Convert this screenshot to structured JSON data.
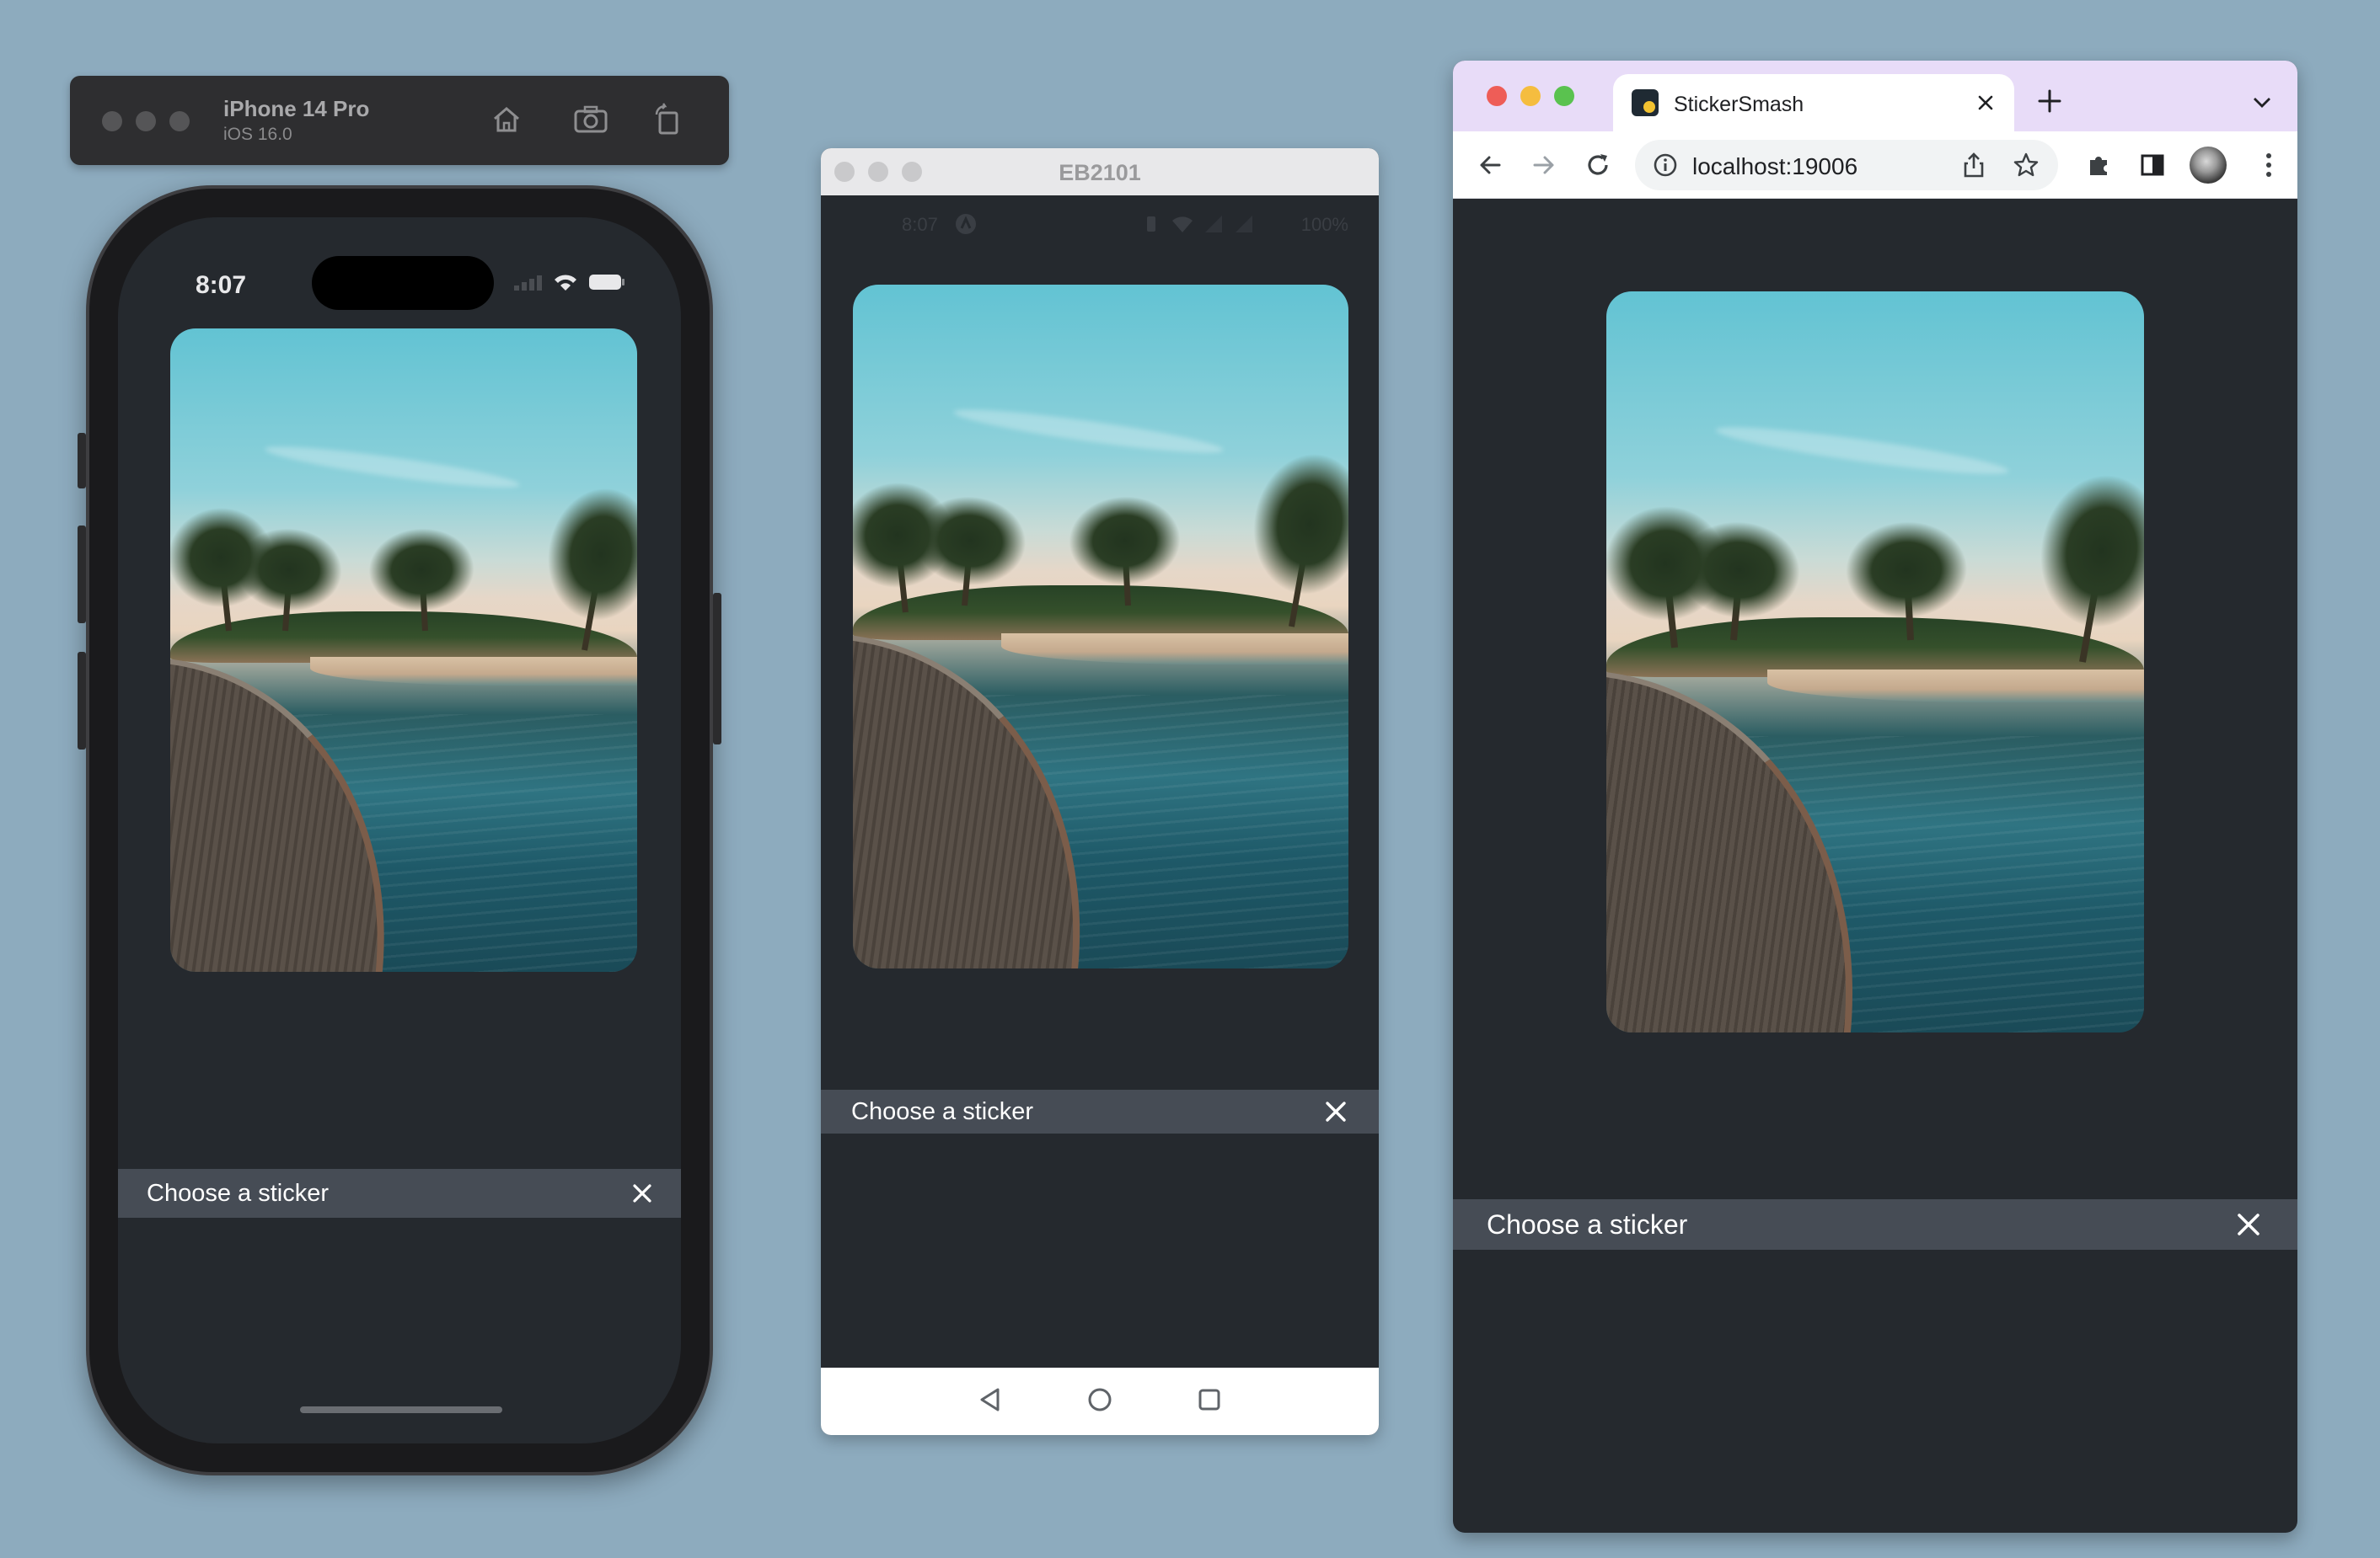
{
  "ios_simulator": {
    "device_name": "iPhone 14 Pro",
    "os_version": "iOS 16.0",
    "toolbar_icons": [
      "home-icon",
      "screenshot-icon",
      "rotate-icon"
    ],
    "status_time": "8:07",
    "sticker_bar_title": "Choose a sticker"
  },
  "android_emulator": {
    "window_title": "EB2101",
    "status_time": "8:07",
    "battery_text": "100%",
    "sticker_bar_title": "Choose a sticker",
    "nav_icons": [
      "back-icon",
      "home-circle-icon",
      "recents-icon"
    ]
  },
  "browser": {
    "tab_title": "StickerSmash",
    "url": "localhost:19006",
    "sticker_bar_title": "Choose a sticker"
  },
  "colors": {
    "desktop_background": "#8dabbe",
    "app_background": "#25292e",
    "sticker_bar": "#464c55",
    "browser_tabstrip": "#e8dcf8"
  }
}
